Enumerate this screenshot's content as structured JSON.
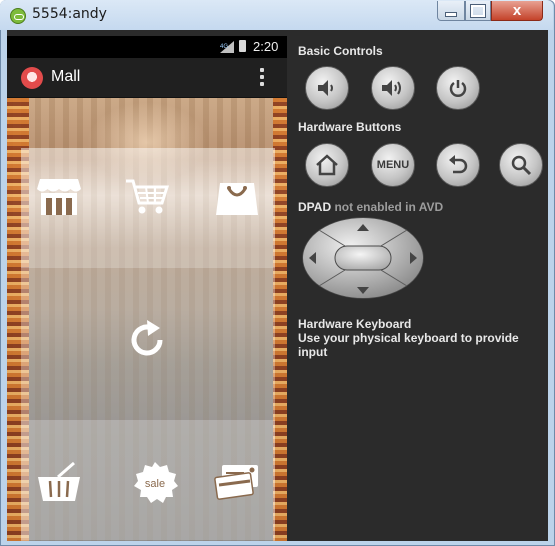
{
  "window": {
    "title": "5554:andy",
    "close_glyph": "x"
  },
  "phone": {
    "status_time": "2:20",
    "app_title": "Mall",
    "icons": {
      "top_row": [
        "store-icon",
        "shopping-cart-icon",
        "shopping-bag-icon"
      ],
      "middle": "refresh-icon",
      "bottom_row": [
        "basket-icon",
        "sale-badge-icon",
        "credit-card-icon"
      ]
    },
    "sale_label": "sale"
  },
  "controls": {
    "basic_controls_label": "Basic Controls",
    "hardware_buttons_label": "Hardware Buttons",
    "menu_label": "MENU",
    "dpad_label": "DPAD",
    "dpad_note": "not enabled in AVD",
    "keyboard_label": "Hardware Keyboard",
    "keyboard_note": "Use your physical keyboard to provide input"
  },
  "colors": {
    "emulator_bg": "#2b2b2b",
    "close_button": "#c4432a",
    "accent_logo": "#e24b4b"
  }
}
